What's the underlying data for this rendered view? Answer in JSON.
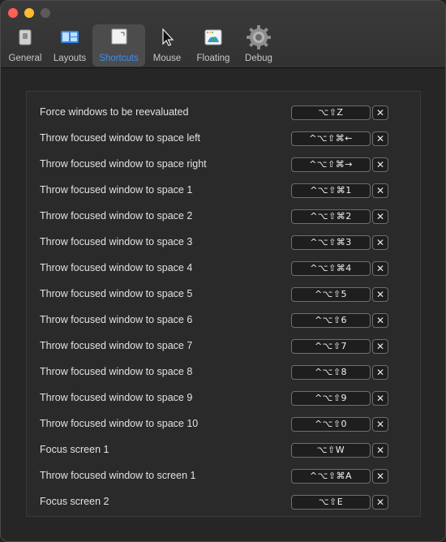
{
  "toolbar": {
    "tabs": [
      {
        "label": "General",
        "icon": "switch-icon"
      },
      {
        "label": "Layouts",
        "icon": "layout-icon"
      },
      {
        "label": "Shortcuts",
        "icon": "shortcut-icon"
      },
      {
        "label": "Mouse",
        "icon": "cursor-icon"
      },
      {
        "label": "Floating",
        "icon": "floating-window-icon"
      },
      {
        "label": "Debug",
        "icon": "gear-icon"
      }
    ],
    "active_tab": "Shortcuts",
    "accent_color": "#3d8ff0"
  },
  "shortcuts": [
    {
      "label": "Force windows to be reevaluated",
      "keys": "⌥⇧Z"
    },
    {
      "label": "Throw focused window to space left",
      "keys": "^⌥⇧⌘←"
    },
    {
      "label": "Throw focused window to space right",
      "keys": "^⌥⇧⌘→"
    },
    {
      "label": "Throw focused window to space 1",
      "keys": "^⌥⇧⌘1"
    },
    {
      "label": "Throw focused window to space 2",
      "keys": "^⌥⇧⌘2"
    },
    {
      "label": "Throw focused window to space 3",
      "keys": "^⌥⇧⌘3"
    },
    {
      "label": "Throw focused window to space 4",
      "keys": "^⌥⇧⌘4"
    },
    {
      "label": "Throw focused window to space 5",
      "keys": "^⌥⇧5"
    },
    {
      "label": "Throw focused window to space 6",
      "keys": "^⌥⇧6"
    },
    {
      "label": "Throw focused window to space 7",
      "keys": "^⌥⇧7"
    },
    {
      "label": "Throw focused window to space 8",
      "keys": "^⌥⇧8"
    },
    {
      "label": "Throw focused window to space 9",
      "keys": "^⌥⇧9"
    },
    {
      "label": "Throw focused window to space 10",
      "keys": "^⌥⇧0"
    },
    {
      "label": "Focus screen 1",
      "keys": "⌥⇧W"
    },
    {
      "label": "Throw focused window to screen 1",
      "keys": "^⌥⇧⌘A"
    },
    {
      "label": "Focus screen 2",
      "keys": "⌥⇧E"
    }
  ],
  "clear_symbol": "✕"
}
